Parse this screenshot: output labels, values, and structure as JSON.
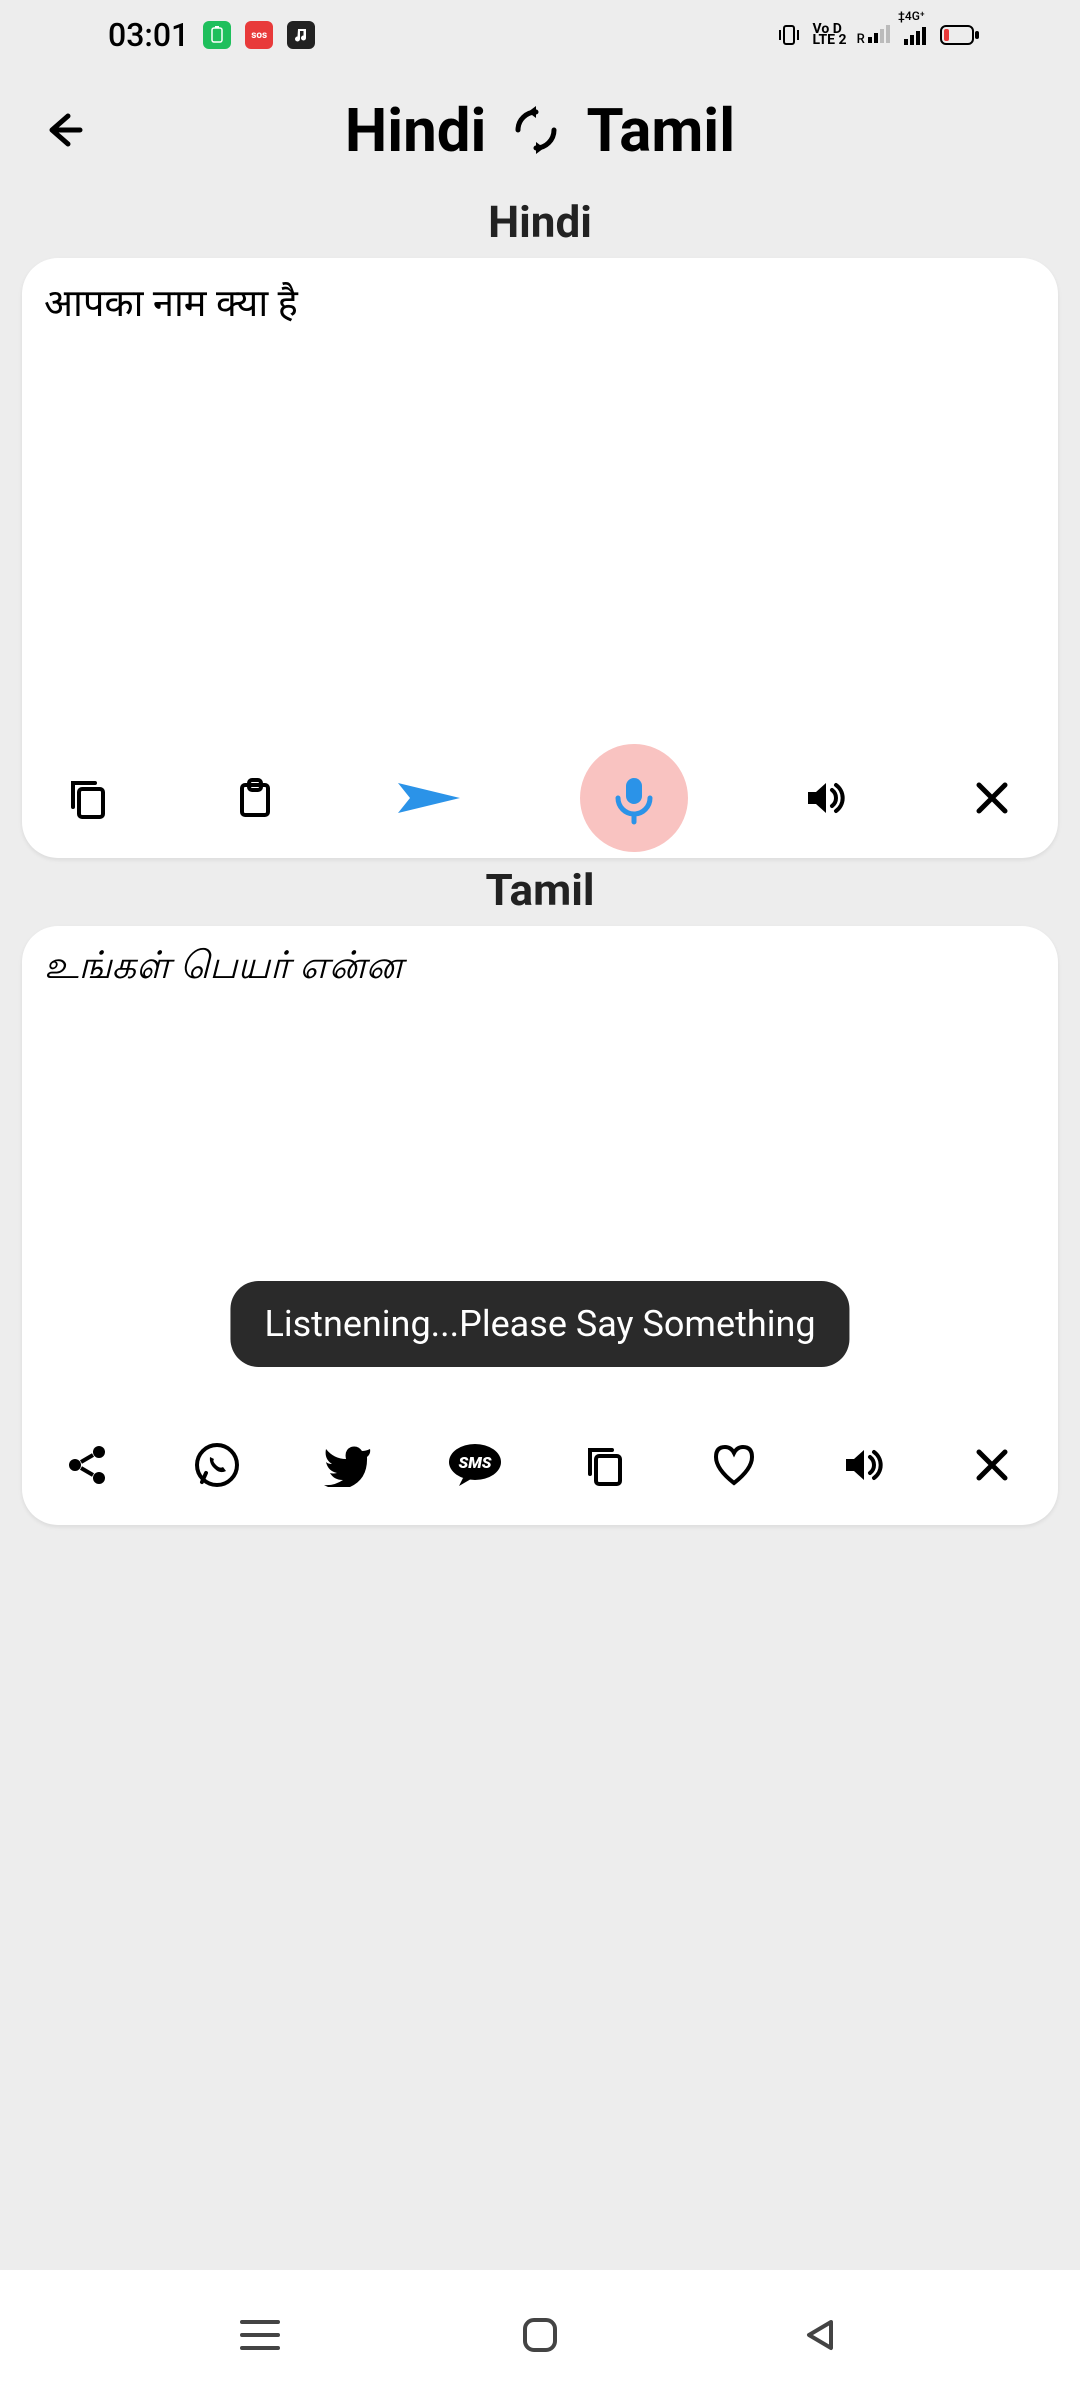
{
  "status": {
    "time": "03:01"
  },
  "header": {
    "lang_from": "Hindi",
    "lang_to": "Tamil"
  },
  "input": {
    "label": "Hindi",
    "text": "आपका नाम क्या है"
  },
  "output": {
    "label": "Tamil",
    "text": "உங்கள் பெயர் என்ன"
  },
  "toast": {
    "text": "Listnening...Please Say Something"
  }
}
